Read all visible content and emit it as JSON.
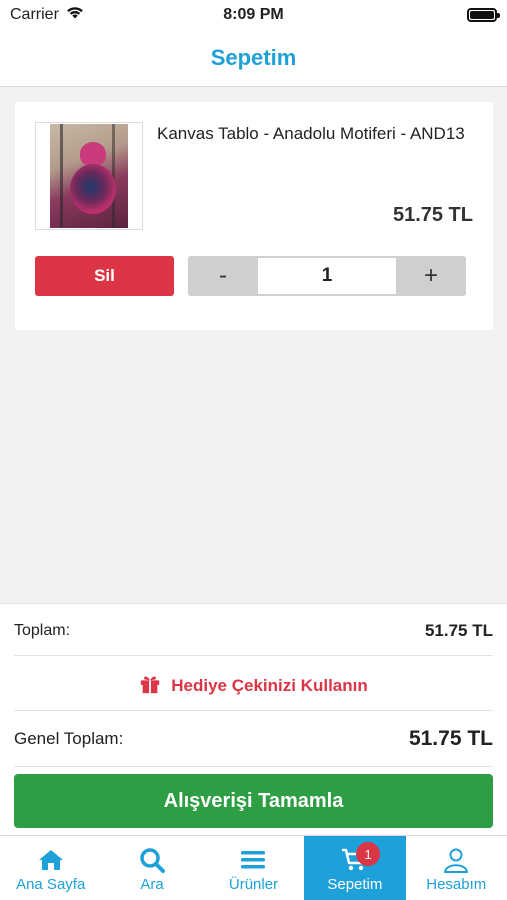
{
  "status_bar": {
    "carrier": "Carrier",
    "time": "8:09 PM"
  },
  "header": {
    "title": "Sepetim",
    "accent_color": "#1ea1d8"
  },
  "cart": {
    "items": [
      {
        "name": "Kanvas Tablo - Anadolu Motiferi - AND13",
        "price": "51.75 TL",
        "delete_label": "Sil",
        "decrement_label": "-",
        "quantity": "1",
        "increment_label": "+"
      }
    ]
  },
  "summary": {
    "subtotal_label": "Toplam:",
    "subtotal_value": "51.75 TL",
    "gift_label": "Hediye Çekinizi Kullanın",
    "total_label": "Genel Toplam:",
    "total_value": "51.75 TL",
    "checkout_label": "Alışverişi Tamamla"
  },
  "tab_bar": {
    "items": [
      {
        "label": "Ana Sayfa",
        "icon": "home-icon"
      },
      {
        "label": "Ara",
        "icon": "search-icon"
      },
      {
        "label": "Ürünler",
        "icon": "menu-icon"
      },
      {
        "label": "Sepetim",
        "icon": "cart-icon",
        "active": true,
        "badge": "1"
      },
      {
        "label": "Hesabım",
        "icon": "user-icon"
      }
    ]
  },
  "colors": {
    "danger": "#dc3545",
    "success": "#2e9e44",
    "primary": "#1ea1d8"
  }
}
